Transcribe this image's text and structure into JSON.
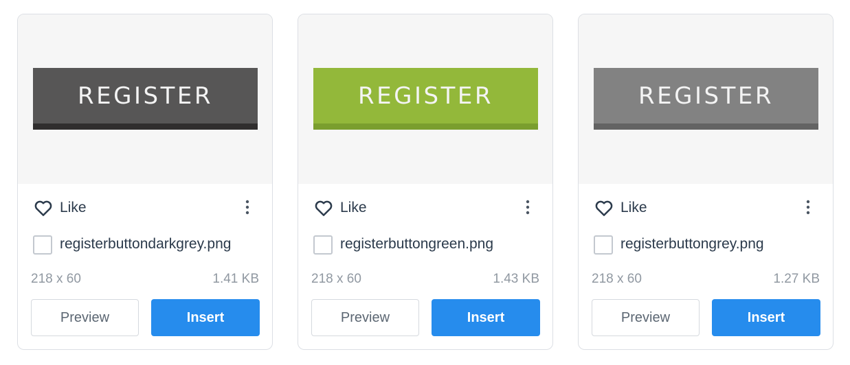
{
  "like_label": "Like",
  "preview_label": "Preview",
  "insert_label": "Insert",
  "button_text": "REGISTER",
  "accent_color": "#268ced",
  "icons": {
    "like": "heart-icon",
    "more": "more-vertical-icon",
    "select": "checkbox"
  },
  "cards": [
    {
      "filename": "registerbuttondarkgrey.png",
      "dimensions": "218 x 60",
      "size": "1.41 KB",
      "button_color": "#575656",
      "stripe_color": "#302e2e"
    },
    {
      "filename": "registerbuttongreen.png",
      "dimensions": "218 x 60",
      "size": "1.43 KB",
      "button_color": "#93b83a",
      "stripe_color": "#7a9e2e"
    },
    {
      "filename": "registerbuttongrey.png",
      "dimensions": "218 x 60",
      "size": "1.27 KB",
      "button_color": "#828282",
      "stripe_color": "#636363"
    }
  ]
}
